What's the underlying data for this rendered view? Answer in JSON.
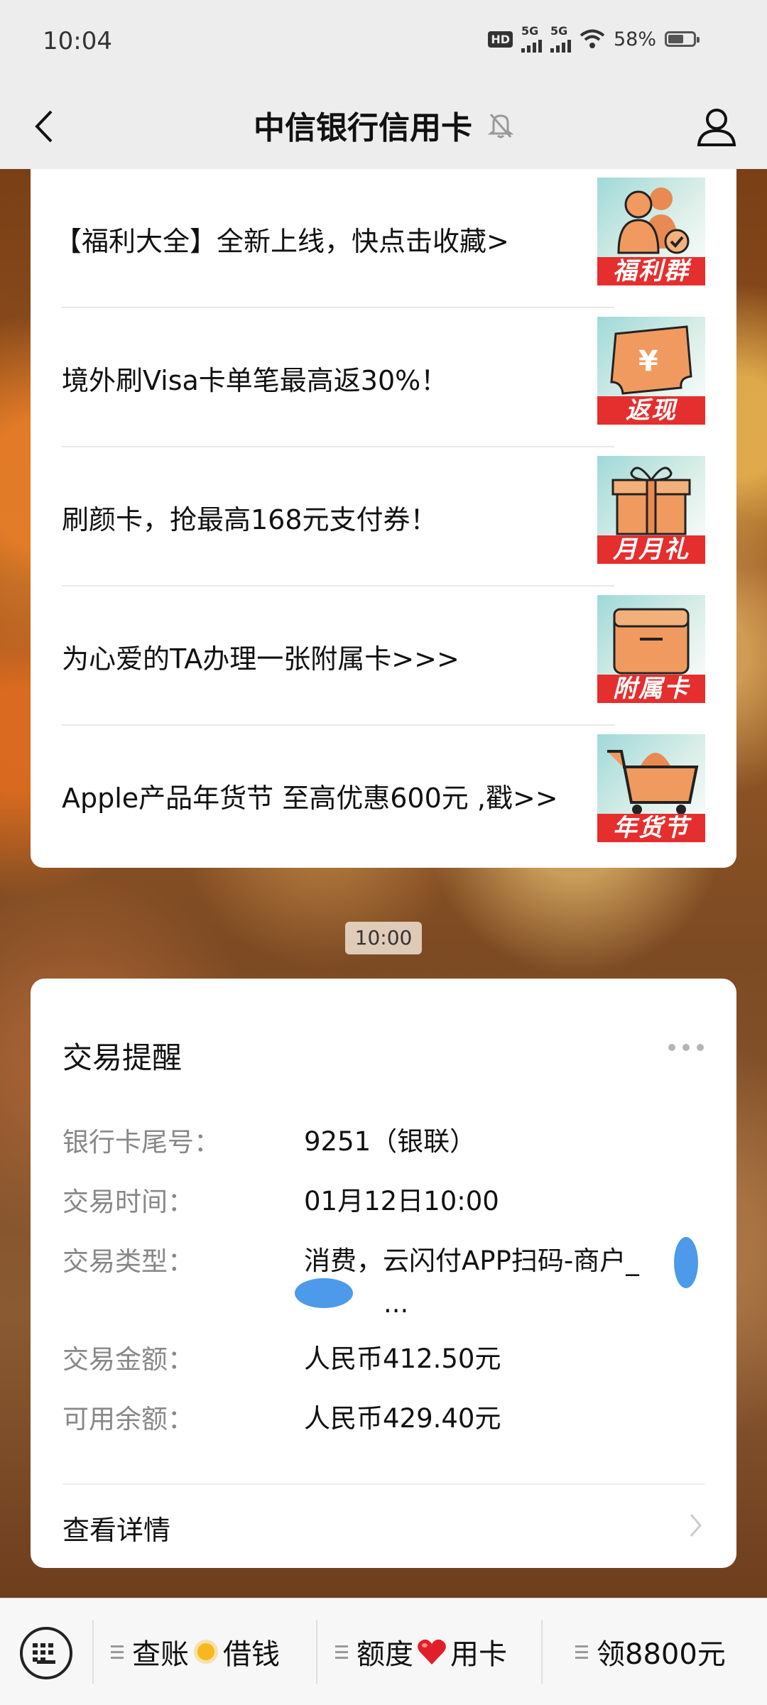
{
  "status_bar": {
    "time": "10:04",
    "network_label_1": "5G",
    "network_label_2": "5G",
    "hd_label": "HD",
    "battery": "58%",
    "icons": [
      "hd-icon",
      "signal-icon",
      "signal-icon",
      "wifi-icon",
      "battery-icon"
    ]
  },
  "header": {
    "title": "中信银行信用卡",
    "icons": [
      "back-arrow-icon",
      "bell-muted-icon",
      "profile-icon"
    ]
  },
  "promos": [
    {
      "text": "【福利大全】全新上线，快点击收藏>",
      "badge": "福利群",
      "icon": "people-check-icon"
    },
    {
      "text": "境外刷Visa卡单笔最高返30%！",
      "badge": "返现",
      "icon": "yen-ticket-icon"
    },
    {
      "text": "刷颜卡，抢最高168元支付券！",
      "badge": "月月礼",
      "icon": "gift-icon"
    },
    {
      "text": "为心爱的TA办理一张附属卡>>>",
      "badge": "附属卡",
      "icon": "card-box-icon"
    },
    {
      "text": "Apple产品年货节 至高优惠600元 ,戳>>",
      "badge": "年货节",
      "icon": "shopping-cart-icon"
    }
  ],
  "timestamp": "10:00",
  "transaction": {
    "title": "交易提醒",
    "rows": [
      {
        "label": "银行卡尾号：",
        "value": "9251（银联）"
      },
      {
        "label": "交易时间：",
        "value": "01月12日10:00"
      },
      {
        "label": "交易类型：",
        "value": "消费，云闪付APP扫码-商户_",
        "value_cont": "..."
      },
      {
        "label": "交易金额：",
        "value": "人民币412.50元"
      },
      {
        "label": "可用余额：",
        "value": "人民币429.40元"
      }
    ],
    "detail_link": "查看详情"
  },
  "bottom_menu": {
    "items": [
      {
        "left": "查账",
        "right": "借钱",
        "emoji": "sun-emoji"
      },
      {
        "left": "额度",
        "right": "用卡",
        "emoji": "heart-emoji"
      },
      {
        "label": "领8800元"
      }
    ],
    "accent_colors": {
      "red_band": "#e52e2e",
      "redaction": "#3a8ee8"
    }
  }
}
